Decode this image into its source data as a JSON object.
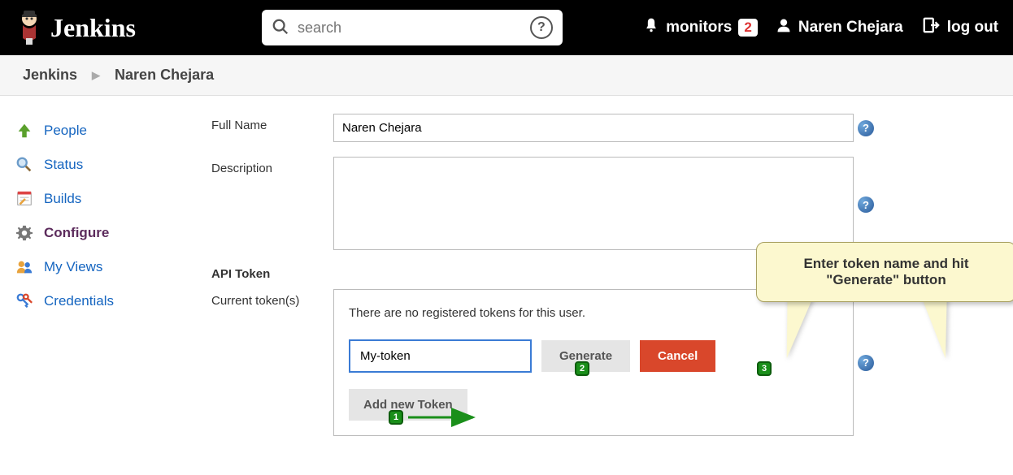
{
  "header": {
    "brand": "Jenkins",
    "search_placeholder": "search",
    "monitors_label": "monitors",
    "monitors_count": "2",
    "user_name": "Naren Chejara",
    "logout_label": "log out"
  },
  "breadcrumb": {
    "root": "Jenkins",
    "current": "Naren Chejara"
  },
  "sidebar": {
    "items": [
      {
        "label": "People"
      },
      {
        "label": "Status"
      },
      {
        "label": "Builds"
      },
      {
        "label": "Configure"
      },
      {
        "label": "My Views"
      },
      {
        "label": "Credentials"
      }
    ]
  },
  "form": {
    "full_name_label": "Full Name",
    "full_name_value": "Naren Chejara",
    "description_label": "Description",
    "description_value": "",
    "api_token_header": "API Token",
    "current_tokens_label": "Current token(s)",
    "no_tokens_msg": "There are no registered tokens for this user.",
    "token_name_value": "My-token",
    "generate_label": "Generate",
    "cancel_label": "Cancel",
    "add_token_label": "Add new Token"
  },
  "annotation": {
    "callout_text": "Enter token name and hit \"Generate\" button",
    "badge1": "1",
    "badge2": "2",
    "badge3": "3"
  }
}
